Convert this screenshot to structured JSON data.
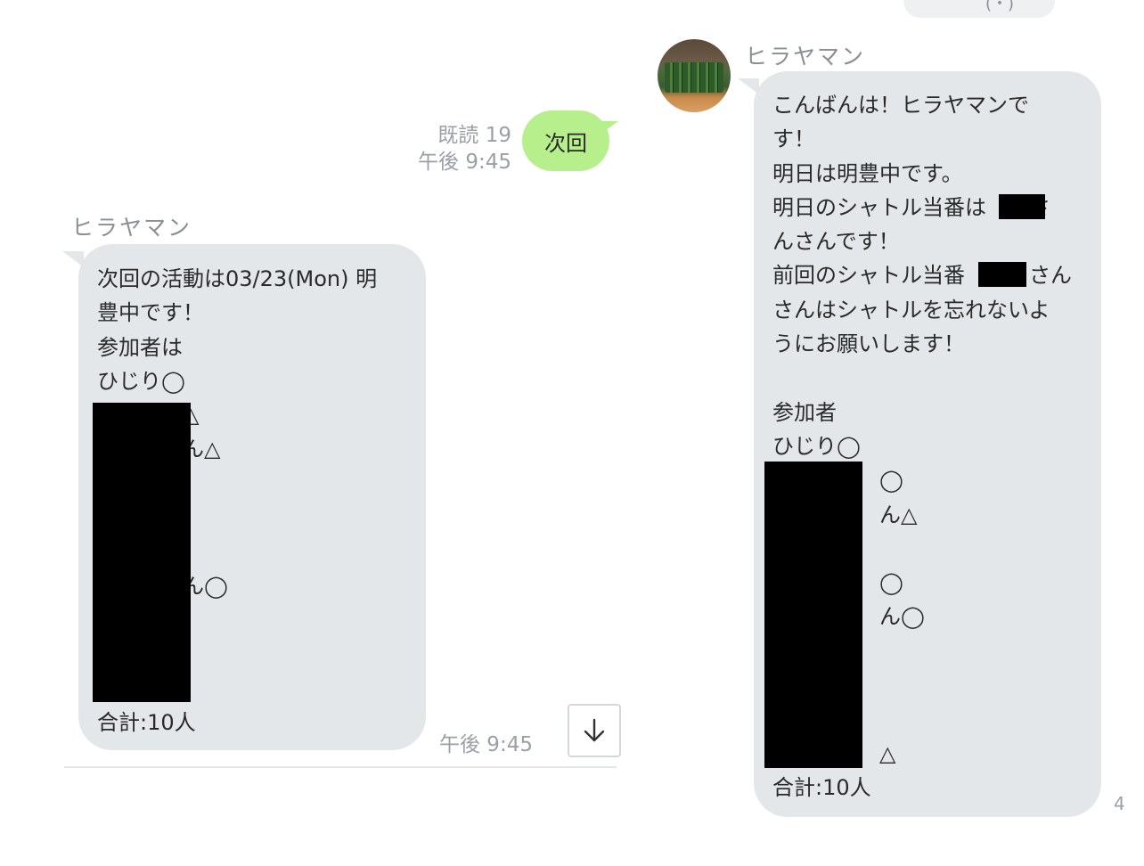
{
  "top_pill_text": "(・)",
  "sent": {
    "text": "次回",
    "read_label": "既読 19",
    "time": "午後 9:45"
  },
  "left_message": {
    "sender": "ヒラヤマン",
    "lines": [
      "次回の活動は03/23(Mon) 明",
      "豊中です！",
      "参加者は",
      "ひじり◯",
      "　　　　△",
      "　　　　ん△",
      "",
      "",
      "",
      "　　　　ん◯",
      "",
      "",
      "",
      "合計:10人"
    ],
    "time": "午後 9:45"
  },
  "right_message": {
    "sender": "ヒラヤマン",
    "lines": [
      "こんばんは！ヒラヤマンで",
      "す！",
      "明日は明豊中です。",
      "明日のシャトル当番は　　さ",
      "んさんです！",
      "前回のシャトル当番　　　さん",
      "さんはシャトルを忘れないよ",
      "うにお願いします！",
      "",
      "参加者",
      "ひじり◯",
      "　　　　　◯",
      "　　　　　ん△",
      "",
      "　　　　　◯",
      "　　　　　ん◯",
      "",
      "",
      "",
      "　　　　　△",
      "合計:10人"
    ]
  },
  "scroll_button_icon": "arrow-down-icon",
  "edge_char": "4",
  "colors": {
    "sent_bubble": "#b6ef8c",
    "received_bubble": "#e3e7ea",
    "meta_text": "#9aa0a6"
  }
}
